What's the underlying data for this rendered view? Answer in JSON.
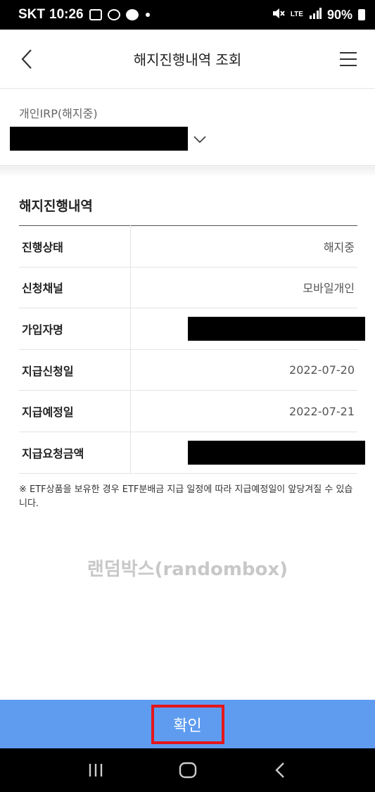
{
  "status_bar": {
    "carrier": "SKT",
    "time": "10:26",
    "network": "LTE",
    "battery": "90%"
  },
  "header": {
    "title": "해지진행내역 조회"
  },
  "account": {
    "label": "개인IRP(해지중)"
  },
  "section": {
    "title": "해지진행내역"
  },
  "details": {
    "rows": [
      {
        "label": "진행상태",
        "value": "해지중"
      },
      {
        "label": "신청채널",
        "value": "모바일개인"
      },
      {
        "label": "가입자명",
        "value": ""
      },
      {
        "label": "지급신청일",
        "value": "2022-07-20"
      },
      {
        "label": "지급예정일",
        "value": "2022-07-21"
      },
      {
        "label": "지급요청금액",
        "value": ""
      }
    ]
  },
  "notice": "※ ETF상품을 보유한 경우 ETF분배금 지급 일정에 따라 지급예정일이 앞당겨질 수 있습니다.",
  "watermark": "랜덤박스(randombox)",
  "confirm_label": "확인",
  "icons": {
    "back": "chevron-left-icon",
    "menu": "hamburger-menu-icon",
    "dropdown": "chevron-down-icon",
    "nav_recents": "recents-icon",
    "nav_home": "home-icon",
    "nav_back": "back-icon"
  }
}
